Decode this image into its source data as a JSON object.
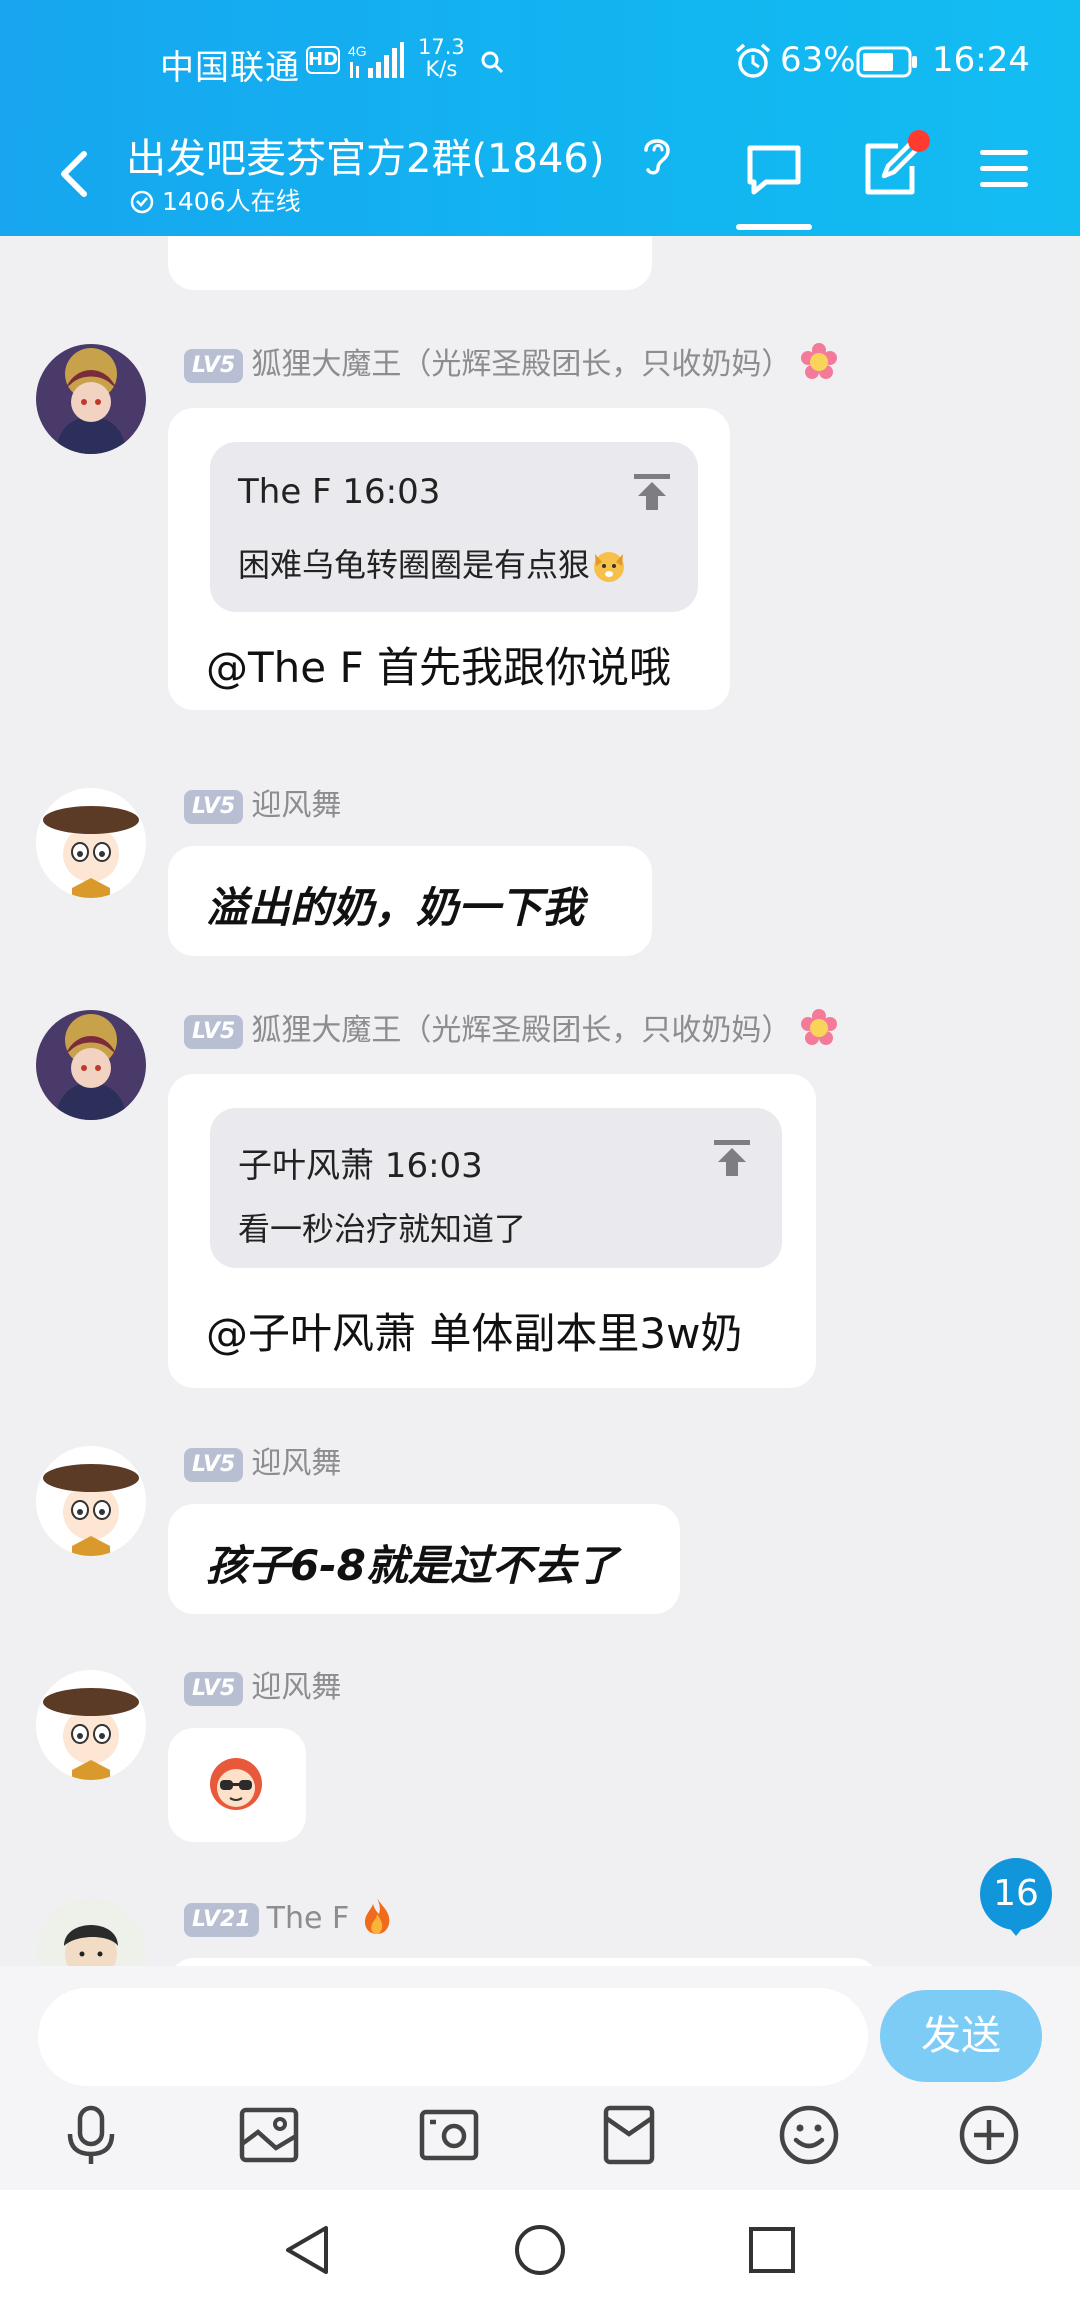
{
  "status_bar": {
    "carrier": "中国联通",
    "hd": "HD",
    "net_type": "4G",
    "speed_value": "17.3",
    "speed_unit": "K/s",
    "battery": "63%",
    "time": "16:24"
  },
  "header": {
    "title": "出发吧麦芬官方2群(1846)",
    "online": "1406人在线"
  },
  "messages": [
    {
      "level": "LV5",
      "sender": "狐狸大魔王（光辉圣殿团长，只收奶妈）",
      "quote_author_time": "The F 16:03",
      "quote_text": "困难乌龟转圈圈是有点狠",
      "text": "@The F 首先我跟你说哦"
    },
    {
      "level": "LV5",
      "sender": "迎风舞",
      "text": "溢出的奶，奶一下我"
    },
    {
      "level": "LV5",
      "sender": "狐狸大魔王（光辉圣殿团长，只收奶妈）",
      "quote_author_time": "子叶风萧 16:03",
      "quote_text": "看一秒治疗就知道了",
      "text": "@子叶风萧 单体副本里3w奶"
    },
    {
      "level": "LV5",
      "sender": "迎风舞",
      "text": "孩子6-8就是过不去了"
    },
    {
      "level": "LV5",
      "sender": "迎风舞",
      "sticker": "sunglasses-girl-sticker"
    },
    {
      "level": "LV21",
      "sender": "The F"
    }
  ],
  "unread_count": "16",
  "input": {
    "placeholder": "",
    "send_label": "发送"
  },
  "toolbar_icons": [
    "microphone-icon",
    "image-icon",
    "camera-icon",
    "red-packet-icon",
    "emoji-icon",
    "plus-icon"
  ],
  "colors": {
    "header": "#17a6ef",
    "send_button": "#7cccf6",
    "badge": "#1296db",
    "level_badge": "#b8bfd3"
  }
}
